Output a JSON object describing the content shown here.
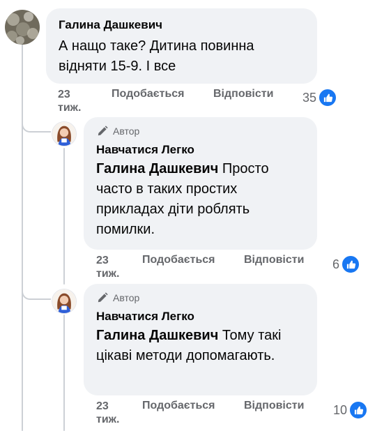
{
  "comments": [
    {
      "name": "Галина Дашкевич",
      "text": "А нащо таке? Дитина повинна відняти 15-9. І все",
      "time": "23 тиж.",
      "like_label": "Подобається",
      "reply_label": "Відповісти",
      "reactions": "35"
    }
  ],
  "replies": [
    {
      "badge": "Автор",
      "name": "Навчатися Легко",
      "mention": "Галина Дашкевич",
      "text": " Просто часто в таких простих прикладах діти роблять помилки.",
      "time": "23 тиж.",
      "like_label": "Подобається",
      "reply_label": "Відповісти",
      "reactions": "6"
    },
    {
      "badge": "Автор",
      "name": "Навчатися Легко",
      "mention": "Галина Дашкевич",
      "text": " Тому такі цікаві методи допомагають.",
      "time": "23 тиж.",
      "like_label": "Подобається",
      "reply_label": "Відповісти",
      "reactions": "10"
    }
  ],
  "colors": {
    "bubble": "#f0f2f5",
    "meta_text": "#65676b",
    "like_blue": "#1877f2",
    "thread_line": "#ccd0d5"
  },
  "icons": {
    "author_badge": "pencil-icon",
    "reaction": "thumbs-up-icon"
  }
}
